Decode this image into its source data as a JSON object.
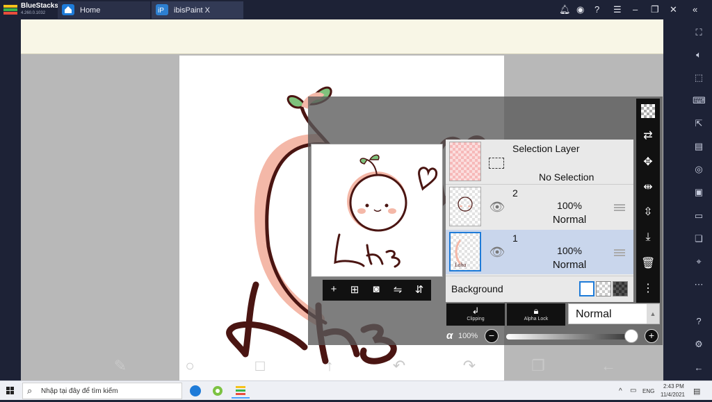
{
  "window": {
    "brand": "BlueStacks",
    "version": "4.260.0.1032",
    "tabs": [
      {
        "label": "Home"
      },
      {
        "label": "ibisPaint X"
      }
    ],
    "controls": [
      "bell-icon",
      "account-icon",
      "help-icon",
      "menu-icon",
      "minimize-icon",
      "restore-icon",
      "close-icon",
      "collapse-icon"
    ]
  },
  "sidebar": {
    "icons": [
      "fullscreen-icon",
      "volume-icon",
      "pointer-icon",
      "keyboard-icon",
      "import-icon",
      "apk-icon",
      "screenshot-icon",
      "record-icon",
      "folder-icon",
      "multi-instance-icon",
      "location-icon",
      "more-icon",
      "help-icon",
      "settings-icon",
      "back-icon"
    ]
  },
  "layers_panel": {
    "layers": [
      {
        "name": "Selection Layer",
        "status": "No Selection"
      },
      {
        "name": "2",
        "opacity": "100%",
        "mode": "Normal"
      },
      {
        "name": "1",
        "opacity": "100%",
        "mode": "Normal"
      }
    ],
    "background_label": "Background",
    "clipping_label": "Clipping",
    "alpha_lock_label": "Alpha Lock",
    "blend_mode": "Normal",
    "opacity_symbol": "α",
    "opacity_value": "100%",
    "opacity_fraction": 1.0
  },
  "drawing": {
    "signature_text": "Laha"
  },
  "taskbar": {
    "search_placeholder": "Nhập tại đây để tìm kiếm",
    "language": "ENG",
    "time": "2:43 PM",
    "date": "11/4/2021"
  },
  "colors": {
    "selected_layer": "#c9d6ec",
    "brand_blue": "#1e7bd8",
    "stroke": "#4a1512",
    "blush": "#f4b8a8",
    "leaf": "#7fc27d"
  }
}
